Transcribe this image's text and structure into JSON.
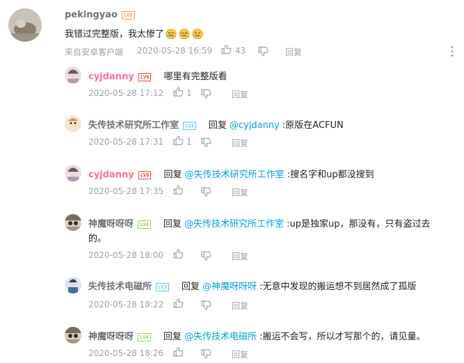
{
  "colors": {
    "accent": "#00a1d6",
    "pink": "#fb7299",
    "meta": "#99a2aa",
    "lv5": "#ff9a3c",
    "lv6": "#ff3b3b",
    "lv3": "#5dc5e0",
    "lv4": "#8bd15c"
  },
  "main": {
    "username": "pekingyao",
    "level": "LV5",
    "text": "我错过完整版，我太惨了",
    "emoji_count": 3,
    "source": "来自安卓客户端",
    "time": "2020-05-28 16:59",
    "likes": "43",
    "reply_label": "回复"
  },
  "replies": [
    {
      "username": "cyjdanny",
      "level": "LV6",
      "prefix": "",
      "mention": "",
      "text": "哪里有完整版看",
      "text2": "",
      "time": "2020-05-28 17:12",
      "likes": "1",
      "reply_label": "回复"
    },
    {
      "username": "失传技术研究所工作室",
      "level": "LV3",
      "prefix": "回复 ",
      "mention": "@cyjdanny",
      "text": " :原版在ACFUN",
      "text2": "",
      "time": "2020-05-28 17:31",
      "likes": "1",
      "reply_label": "回复"
    },
    {
      "username": "cyjdanny",
      "level": "LV6",
      "prefix": "回复 ",
      "mention": "@失传技术研究所工作室",
      "text": " :搜名字和up都没搜到",
      "text2": "",
      "time": "2020-05-28 17:35",
      "likes": "",
      "reply_label": "回复"
    },
    {
      "username": "神魔呀呀呀",
      "level": "LV4",
      "prefix": "回复 ",
      "mention": "@失传技术研究所工作室",
      "text": " :up是独家up，那没有，只有盗过去",
      "text2": "的。",
      "time": "2020-05-28 18:00",
      "likes": "",
      "reply_label": "回复"
    },
    {
      "username": "失传技术电磁所",
      "level": "LV3",
      "prefix": "回复 ",
      "mention": "@神魔呀呀呀",
      "text": " :无意中发现的搬运想不到居然成了孤版",
      "text2": "",
      "time": "2020-05-28 18:22",
      "likes": "",
      "reply_label": "回复"
    },
    {
      "username": "神魔呀呀呀",
      "level": "LV4",
      "prefix": "回复 ",
      "mention": "@失传技术电磁所",
      "text": " :搬运不会写，所以才写那个的，请见量。",
      "text2": "",
      "time": "2020-05-28 18:26",
      "likes": "",
      "reply_label": "回复"
    }
  ]
}
